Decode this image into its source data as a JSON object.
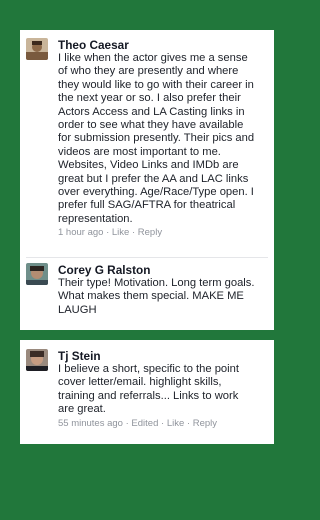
{
  "comments": [
    {
      "author": "Theo Caesar",
      "text": "I like when the actor gives me a sense\nof who they are presently and where\nthey would like to go with their career in\nthe next year or so. I also prefer their\nActors Access and LA Casting links in\norder to see what they have available\nfor submission presently. Their pics and\nvideos are most important to me.\nWebsites, Video Links  and IMDb are\ngreat but I prefer the AA and LAC links\nover everything. Age/Race/Type open. I\nprefer full SAG/AFTRA for theatrical\nrepresentation.",
      "time": "1 hour ago",
      "edited": "",
      "like": "Like",
      "reply": "Reply"
    },
    {
      "author": "Corey G Ralston",
      "text": "Their type! Motivation. Long term goals.\nWhat makes them special. MAKE ME\nLAUGH",
      "time": "",
      "edited": "",
      "like": "",
      "reply": ""
    },
    {
      "author": "Tj Stein",
      "text": "I believe a short, specific to the point\ncover letter/email.  highlight skills,\ntraining and referrals... Links to work\nare great.",
      "time": "55 minutes ago",
      "edited": "Edited",
      "like": "Like",
      "reply": "Reply"
    }
  ],
  "separator": " · "
}
